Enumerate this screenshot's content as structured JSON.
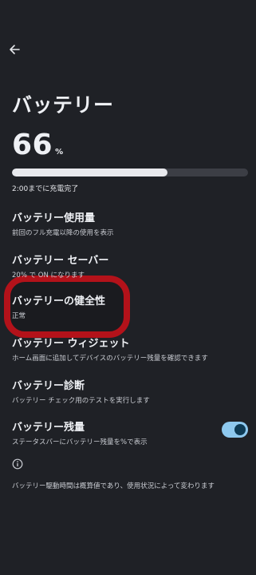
{
  "header": {
    "back_icon": "arrow-left-icon"
  },
  "title": "バッテリー",
  "battery": {
    "level_value": "66",
    "level_unit": "%",
    "level_fraction": 0.66,
    "charge_status": "2:00までに充電完了"
  },
  "items": [
    {
      "title": "バッテリー使用量",
      "subtitle": "前回のフル充電以降の使用を表示"
    },
    {
      "title": "バッテリー セーバー",
      "subtitle": "20% で ON になります"
    },
    {
      "title": "バッテリーの健全性",
      "subtitle": "正常"
    },
    {
      "title": "バッテリー ウィジェット",
      "subtitle": "ホーム画面に追加してデバイスのバッテリー残量を確認できます"
    },
    {
      "title": "バッテリー診断",
      "subtitle": "バッテリー チェック用のテストを実行します"
    },
    {
      "title": "バッテリー残量",
      "subtitle": "ステータスバーにバッテリー残量を%で表示"
    }
  ],
  "percentage_toggle": {
    "on": true,
    "track_color": "#8ec9ef",
    "knob_color": "#0e3b55"
  },
  "highlight_color": "#b3121a",
  "info_icon": "info-circle-icon",
  "footnote": "バッテリー駆動時間は概算値であり、使用状況によって変わります"
}
